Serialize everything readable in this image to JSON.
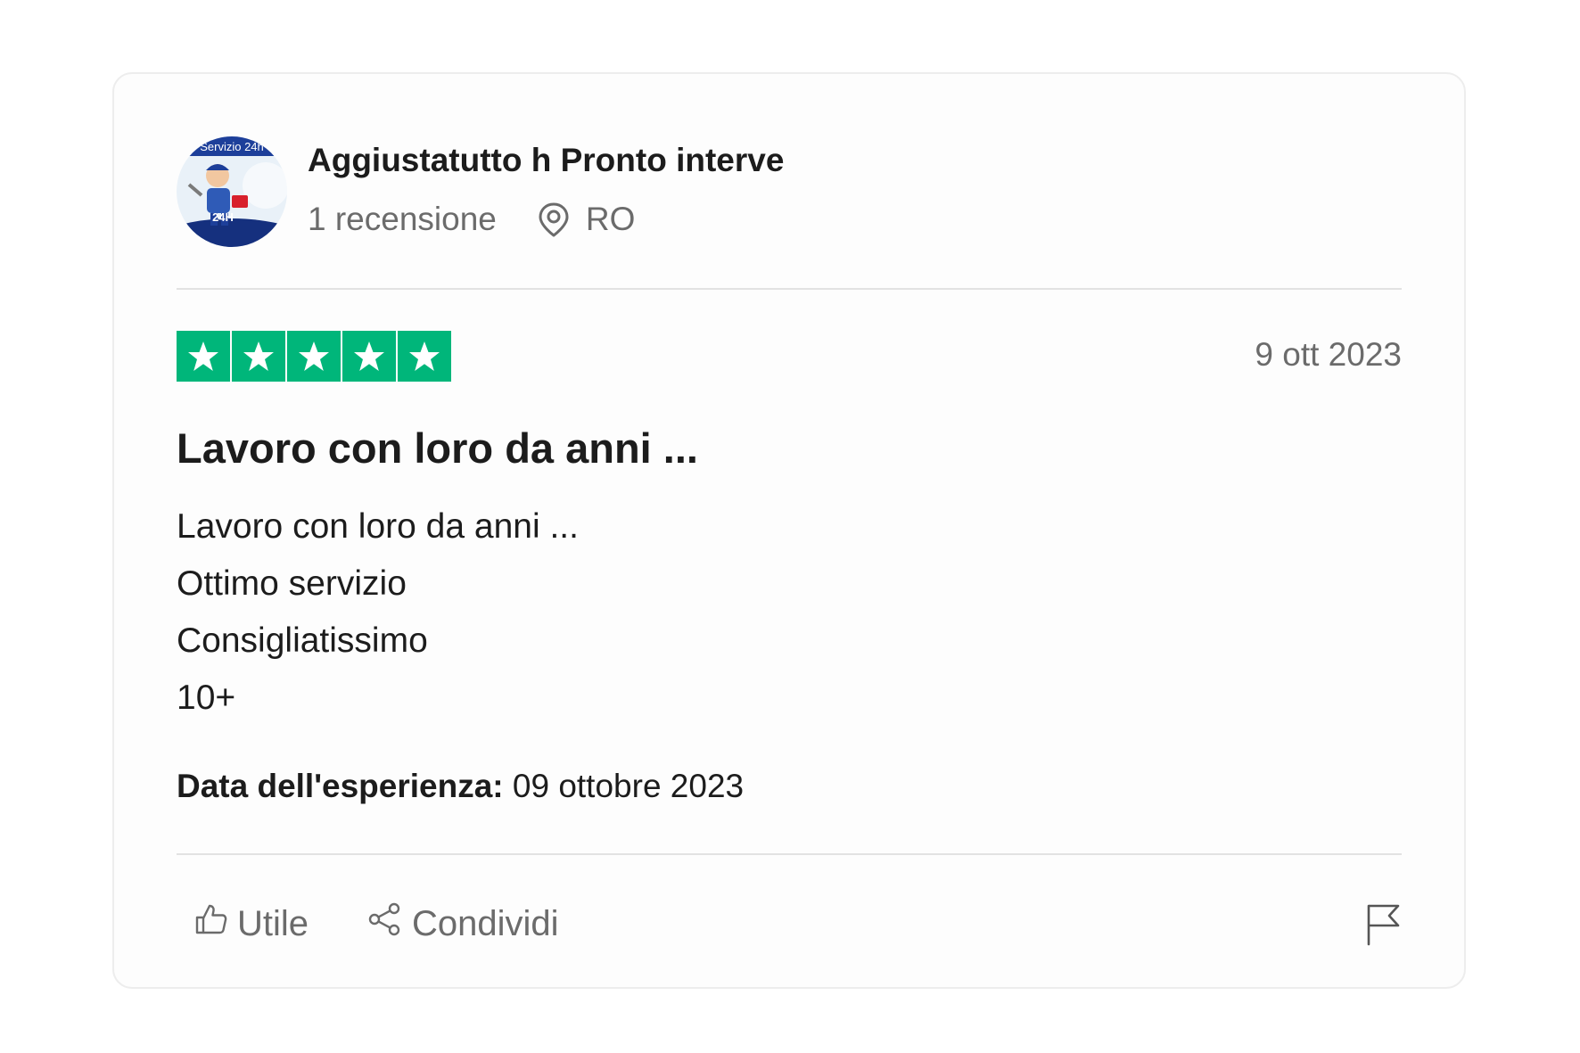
{
  "reviewer": {
    "name": "Aggiustatutto h Pronto interve",
    "review_count": "1 recensione",
    "country": "RO",
    "avatar_text_top": "Servizio 24h",
    "avatar_badge": "24H"
  },
  "review": {
    "rating": 5,
    "rating_max": 5,
    "star_color": "#00b67a",
    "date": "9 ott 2023",
    "title": "Lavoro con loro da anni ...",
    "body_lines": [
      "Lavoro con loro da anni ...",
      "Ottimo servizio",
      "Consigliatissimo",
      "10+"
    ],
    "experience_label": "Data dell'esperienza:",
    "experience_date": "09 ottobre 2023"
  },
  "actions": {
    "useful_label": "Utile",
    "share_label": "Condividi"
  },
  "icons": {
    "location": "map-pin-icon",
    "useful": "thumbs-up-icon",
    "share": "share-icon",
    "report": "flag-icon",
    "star": "star-icon"
  }
}
